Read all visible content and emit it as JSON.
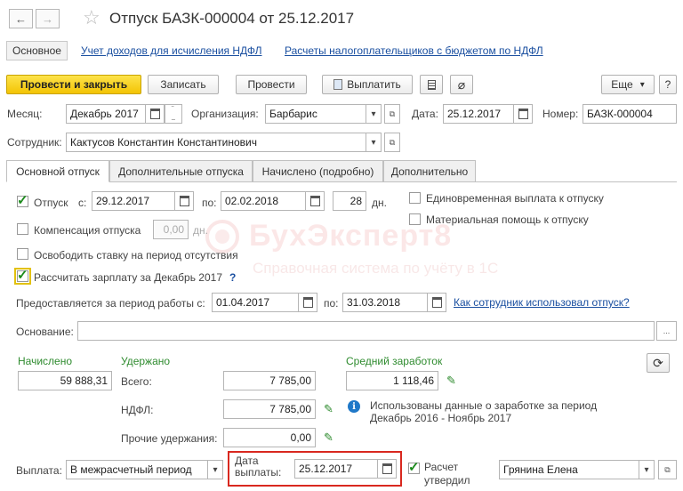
{
  "window": {
    "title": "Отпуск БАЗК-000004 от 25.12.2017",
    "back": "←",
    "forward": "→"
  },
  "sections": {
    "main": "Основное",
    "link1": "Учет доходов для исчисления НДФЛ",
    "link2": "Расчеты налогоплательщиков с бюджетом по НДФЛ"
  },
  "toolbar": {
    "post_close": "Провести и закрыть",
    "save": "Записать",
    "post": "Провести",
    "pay": "Выплатить",
    "more": "Еще",
    "help": "?"
  },
  "header": {
    "month_label": "Месяц:",
    "month_value": "Декабрь 2017",
    "org_label": "Организация:",
    "org_value": "Барбарис",
    "date_label": "Дата:",
    "date_value": "25.12.2017",
    "number_label": "Номер:",
    "number_value": "БАЗК-000004",
    "employee_label": "Сотрудник:",
    "employee_value": "Кактусов Константин Константинович"
  },
  "tabs": [
    "Основной отпуск",
    "Дополнительные отпуска",
    "Начислено (подробно)",
    "Дополнительно"
  ],
  "vacation": {
    "label": "Отпуск",
    "from_label": "с:",
    "from_value": "29.12.2017",
    "to_label": "по:",
    "to_value": "02.02.2018",
    "days_value": "28",
    "days_unit": "дн.",
    "single_payment": "Единовременная выплата к отпуску",
    "material_help": "Материальная помощь к отпуску",
    "compensation": "Компенсация отпуска",
    "comp_value": "0,00",
    "comp_unit": "дн.",
    "free_rate": "Освободить ставку на период отсутствия",
    "calc_salary": "Рассчитать зарплату за Декабрь 2017",
    "calc_help": "?",
    "period_label": "Предоставляется за период работы с:",
    "period_from": "01.04.2017",
    "period_to_label": "по:",
    "period_to": "31.03.2018",
    "usage_link": "Как сотрудник использовал отпуск?",
    "basis_label": "Основание:",
    "basis_btn": "..."
  },
  "totals": {
    "accrued_label": "Начислено",
    "accrued_value": "59 888,31",
    "withheld_label": "Удержано",
    "total_label": "Всего:",
    "total_value": "7 785,00",
    "ndfl_label": "НДФЛ:",
    "ndfl_value": "7 785,00",
    "other_label": "Прочие удержания:",
    "other_value": "0,00",
    "avg_label": "Средний заработок",
    "avg_value": "1 118,46",
    "info_line1": "Использованы данные о заработке за период",
    "info_line2": "Декабрь 2016 - Ноябрь 2017"
  },
  "footer": {
    "payout_label": "Выплата:",
    "payout_value": "В межрасчетный период",
    "paydate_line1": "Дата",
    "paydate_line2": "выплаты:",
    "paydate_value": "25.12.2017",
    "calc_line1": "Расчет",
    "calc_line2": "утвердил",
    "approver": "Грянина Елена"
  },
  "watermark": {
    "title": "БухЭксперт8",
    "subtitle": "Справочная система по учёту в 1С"
  },
  "colors": {
    "accent_yellow": "#f3c404",
    "link_blue": "#1a4fa0",
    "green_label": "#2e8b2e",
    "highlight_red": "#d9281f"
  }
}
